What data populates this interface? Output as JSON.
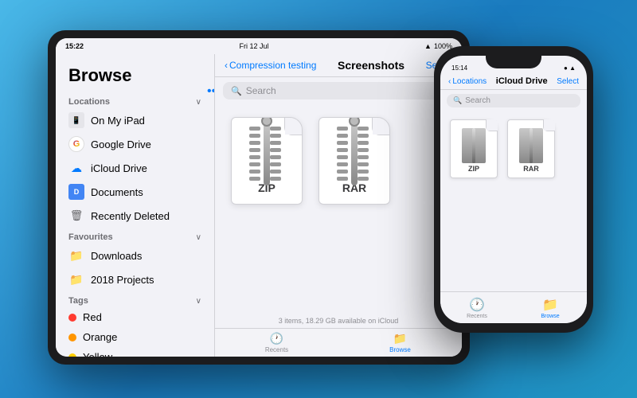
{
  "ipad": {
    "status": {
      "time": "15:22",
      "date": "Fri 12 Jul",
      "battery": "100%",
      "wifi": true
    },
    "sidebar": {
      "title": "Browse",
      "dots_icon": "•••",
      "sections": [
        {
          "label": "Locations",
          "items": [
            {
              "name": "On My iPad",
              "icon": "ipad"
            },
            {
              "name": "Google Drive",
              "icon": "google"
            },
            {
              "name": "iCloud Drive",
              "icon": "icloud"
            },
            {
              "name": "Documents",
              "icon": "docs"
            },
            {
              "name": "Recently Deleted",
              "icon": "trash"
            }
          ]
        },
        {
          "label": "Favourites",
          "items": [
            {
              "name": "Downloads",
              "icon": "folder"
            },
            {
              "name": "2018 Projects",
              "icon": "folder"
            }
          ]
        },
        {
          "label": "Tags",
          "items": [
            {
              "name": "Red",
              "icon": "dot-red"
            },
            {
              "name": "Orange",
              "icon": "dot-orange"
            },
            {
              "name": "Yellow",
              "icon": "dot-yellow"
            }
          ]
        }
      ]
    },
    "main": {
      "back_label": "Compression testing",
      "title": "Screenshots",
      "select_label": "Select",
      "search_placeholder": "Search",
      "files": [
        {
          "ext": "ZIP"
        },
        {
          "ext": "RAR"
        }
      ],
      "status_text": "3 items, 18.29 GB available on iCloud"
    },
    "tabs": [
      {
        "label": "Recents",
        "icon": "🕐",
        "active": false
      },
      {
        "label": "Browse",
        "icon": "📁",
        "active": true
      }
    ]
  },
  "iphone": {
    "status": {
      "time": "15:14",
      "battery": "▮▮▮"
    },
    "nav": {
      "back_label": "Locations",
      "title": "iCloud Drive",
      "select_label": "Select"
    },
    "search_placeholder": "Search",
    "files": [
      {
        "ext": "ZIP"
      },
      {
        "ext": "RAR"
      }
    ],
    "tabs": [
      {
        "label": "Recents",
        "icon": "🕐",
        "active": false
      },
      {
        "label": "Browse",
        "icon": "📁",
        "active": true
      }
    ]
  }
}
